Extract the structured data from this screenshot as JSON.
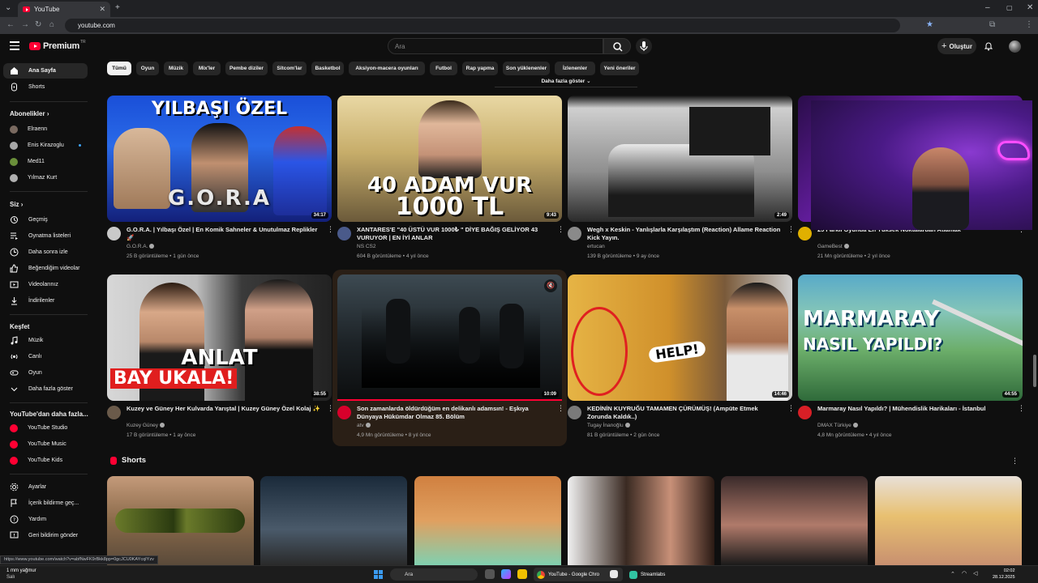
{
  "browser": {
    "tab_title": "YouTube",
    "url": "youtube.com"
  },
  "header": {
    "logo_text": "Premium",
    "logo_badge": "TR",
    "search_placeholder": "Ara",
    "create_label": "Oluştur"
  },
  "sidebar": {
    "top": [
      {
        "label": "Ana Sayfa",
        "icon": "home-icon",
        "active": true
      },
      {
        "label": "Shorts",
        "icon": "shorts-icon"
      }
    ],
    "subs_heading": "Abonelikler",
    "subscriptions": [
      {
        "label": "Elraenn",
        "color": "#7a6a60"
      },
      {
        "label": "Enis Kirazoglu",
        "color": "#a8a8a8",
        "live": true
      },
      {
        "label": "Med11",
        "color": "#6a8f3a"
      },
      {
        "label": "Yılmaz Kurt",
        "color": "#b0b0b0"
      }
    ],
    "you_heading": "Siz",
    "you": [
      {
        "label": "Geçmiş",
        "icon": "history-icon"
      },
      {
        "label": "Oynatma listeleri",
        "icon": "playlists-icon"
      },
      {
        "label": "Daha sonra izle",
        "icon": "watch-later-icon"
      },
      {
        "label": "Beğendiğim videolar",
        "icon": "like-icon"
      },
      {
        "label": "Videolarınız",
        "icon": "your-videos-icon"
      },
      {
        "label": "İndirilenler",
        "icon": "download-icon"
      }
    ],
    "explore_heading": "Keşfet",
    "explore": [
      {
        "label": "Müzik",
        "icon": "music-icon"
      },
      {
        "label": "Canlı",
        "icon": "live-icon"
      },
      {
        "label": "Oyun",
        "icon": "gaming-icon"
      },
      {
        "label": "Daha fazla göster",
        "icon": "chevron-down-icon"
      }
    ],
    "more_heading": "YouTube'dan daha fazla...",
    "more": [
      {
        "label": "YouTube Studio"
      },
      {
        "label": "YouTube Music"
      },
      {
        "label": "YouTube Kids"
      }
    ],
    "settings": [
      {
        "label": "Ayarlar",
        "icon": "settings-icon"
      },
      {
        "label": "İçerik bildirme geç...",
        "icon": "flag-icon"
      },
      {
        "label": "Yardım",
        "icon": "help-icon"
      },
      {
        "label": "Geri bildirim gönder",
        "icon": "feedback-icon"
      }
    ]
  },
  "chips": [
    "Tümü",
    "Oyun",
    "Müzik",
    "Mix'ler",
    "Pembe diziler",
    "Sitcom'lar",
    "Basketbol",
    "Aksiyon-macera oyunları",
    "Futbol",
    "Rap yapma",
    "Son yüklenenler",
    "İzlenenler",
    "Yeni öneriler"
  ],
  "show_more": "Daha fazla göster",
  "videos": [
    {
      "title": "G.O.R.A. | Yılbaşı Özel | En Komik Sahneler & Unutulmaz Replikler 🚀",
      "channel": "G.O.R.A.",
      "meta": "25 B görüntüleme • 1 gün önce",
      "duration": "34:17",
      "thumb_text": "YILBAŞI ÖZEL",
      "thumb_text2": "G.O.R.A",
      "avatar_color": "#c9c9c9"
    },
    {
      "title": "XANTARES'E \"40 ÜSTÜ VUR 1000₺ \" DİYE BAĞIŞ GELİYOR 43 VURUYOR | EN İYİ ANLAR",
      "channel": "NS CS2",
      "meta": "604 B görüntüleme • 4 yıl önce",
      "duration": "9:43",
      "thumb_text": "40 ADAM VUR",
      "thumb_text2": "1000 TL",
      "avatar_color": "#4a5a8a"
    },
    {
      "title": "Wegh x Keskin - Yanlışlarla Karşılaştım (Reaction) Allame Reaction Kick Yayın.",
      "channel": "ertucan",
      "meta": "139 B görüntüleme • 9 ay önce",
      "duration": "2:49",
      "thumb_text": "",
      "thumb_text2": "",
      "avatar_color": "#8a8a8a"
    },
    {
      "title": "25 Farklı Oyunda En Yüksek Noktalardan Atlamak",
      "channel": "GameBest",
      "meta": "21 Mn görüntüleme • 2 yıl önce",
      "duration": "",
      "thumb_text": "",
      "thumb_text2": "",
      "avatar_color": "#e0b000"
    },
    {
      "title": "Kuzey ve Güney Her Kulvarda Yarıştal | Kuzey Güney Özel Kolaj ✨",
      "channel": "Kuzey Güney",
      "meta": "17 B görüntüleme • 1 ay önce",
      "duration": "38:55",
      "thumb_text": "ANLAT",
      "thumb_text2": "BAY UKALA!",
      "avatar_color": "#6a5a4a"
    },
    {
      "title": "Son zamanlarda öldürdüğüm en delikanlı adamsın! - Eşkıya Dünyaya Hükümdar Olmaz 85. Bölüm",
      "channel": "atv",
      "meta": "4,9 Mn görüntüleme • 8 yıl önce",
      "duration": "10:09",
      "thumb_text": "",
      "thumb_text2": "",
      "avatar_color": "#d8002b"
    },
    {
      "title": "KEDİNİN KUYRUĞU TAMAMEN ÇÜRÜMÜŞ! (Ampüte Etmek Zorunda Kaldık..)",
      "channel": "Tugay İnanoğlu",
      "meta": "81 B görüntüleme • 2 gün önce",
      "duration": "14:46",
      "thumb_text": "HELP!",
      "thumb_text2": "",
      "avatar_color": "#7a7a7a"
    },
    {
      "title": "Marmaray Nasıl Yapıldı? | Mühendislik Harikaları - İstanbul",
      "channel": "DMAX Türkiye",
      "meta": "4,8 Mn görüntüleme • 4 yıl önce",
      "duration": "44:55",
      "thumb_text": "MARMARAY",
      "thumb_text2": "NASIL YAPILDI?",
      "avatar_color": "#d81f26"
    }
  ],
  "shorts_heading": "Shorts",
  "status_url": "https://www.youtube.com/watch?v=abfNwFK9rBkk8pp=0gcJCU0KAYcqIYzv",
  "taskbar": {
    "weather": "1 mm yağmur",
    "weather_sub": "Salı",
    "search": "Ara",
    "chrome_label": "YouTube - Google Chro",
    "streamlabs_label": "Streamlabs",
    "time": "02:02",
    "date": "28.12.2025"
  },
  "colors": {
    "background": "#0f0f0f",
    "chip": "#272727",
    "brand": "#ff0033",
    "meta_text": "#aaaaaa"
  }
}
